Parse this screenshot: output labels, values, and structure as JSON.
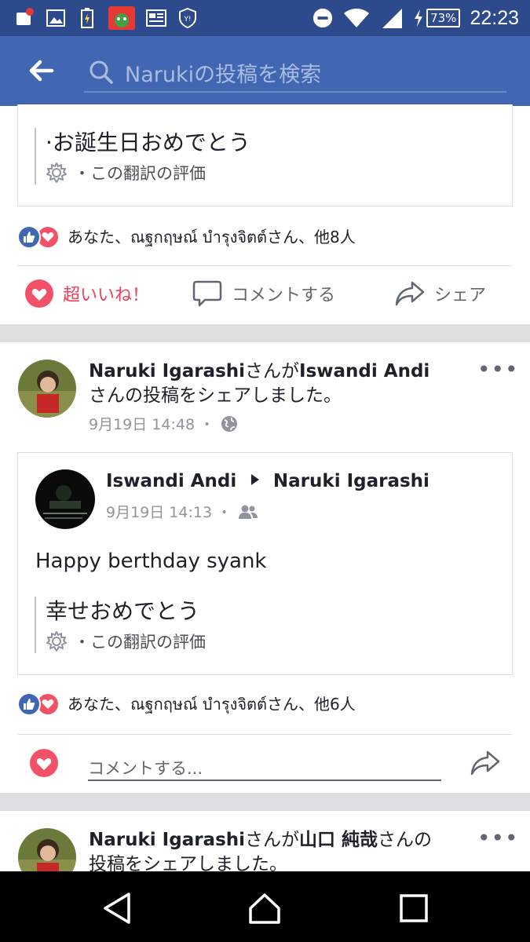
{
  "status_bar": {
    "time": "22:23",
    "battery": "73%",
    "app_icon_label": "Shufoo!"
  },
  "search": {
    "placeholder": "Narukiの投稿を検索"
  },
  "post1": {
    "translation_text": "·お誕生日おめでとう",
    "translation_rate": "・この翻訳の評価",
    "reactions_text": "あなた、ณฐกฤษณ์ บำรุงจิตต์さん、他8人",
    "actions": {
      "love": "超いいね！",
      "comment": "コメントする",
      "share": "シェア"
    }
  },
  "post2": {
    "sharer": "Naruki Igarashi",
    "shared_from": "Iswandi Andi",
    "header_mid": "さんが",
    "header_tail": "さんの投稿をシェアしました。",
    "time": "9月19日 14:48 ・",
    "inner": {
      "author": "Iswandi Andi",
      "target": "Naruki Igarashi",
      "time": "9月19日 14:13 ・",
      "body": "Happy berthday syank",
      "translation_text": "幸せおめでとう",
      "translation_rate": "・この翻訳の評価"
    },
    "reactions_text": "あなた、ณฐกฤษณ์ บำรุงจิตต์さん、他6人",
    "comment_placeholder": "コメントする..."
  },
  "post3": {
    "sharer": "Naruki Igarashi",
    "shared_from": "山口 純哉",
    "header_mid": "さんが",
    "header_tail": "さんの投稿をシェアしました。"
  },
  "colors": {
    "status_bar": "#2d4b8c",
    "top_bar": "#4267b2",
    "love": "#f33e58"
  }
}
